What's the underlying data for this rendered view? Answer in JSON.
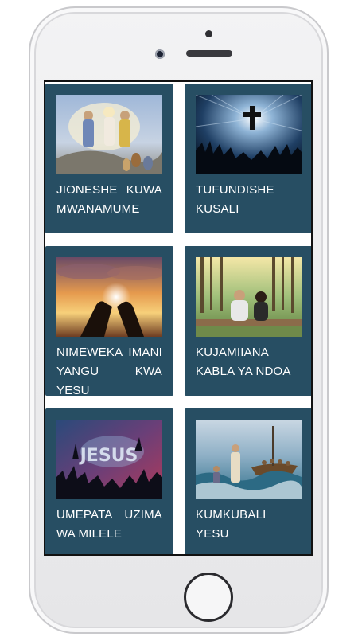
{
  "colors": {
    "card_background": "#274e63",
    "screen_background": "#ffffff",
    "text": "#ffffff"
  },
  "cards": [
    {
      "title": "JIONESHE KUWA MWANAMUME",
      "image": "prophets-on-clouds-painting"
    },
    {
      "title": "TUFUNDISHE KUSALI",
      "image": "glowing-cross-raised-hands"
    },
    {
      "title": "NIMEWEKA IMANI YANGU KWA YESU",
      "image": "hands-holding-light-sunset"
    },
    {
      "title": "KUJAMIIANA KABLA YA NDOA",
      "image": "couple-sitting-in-forest"
    },
    {
      "title": "UMEPATA UZIMA WA MILELE",
      "image": "jesus-worship-concert"
    },
    {
      "title": "KUMKUBALI YESU",
      "image": "jesus-walking-on-water-painting"
    }
  ]
}
